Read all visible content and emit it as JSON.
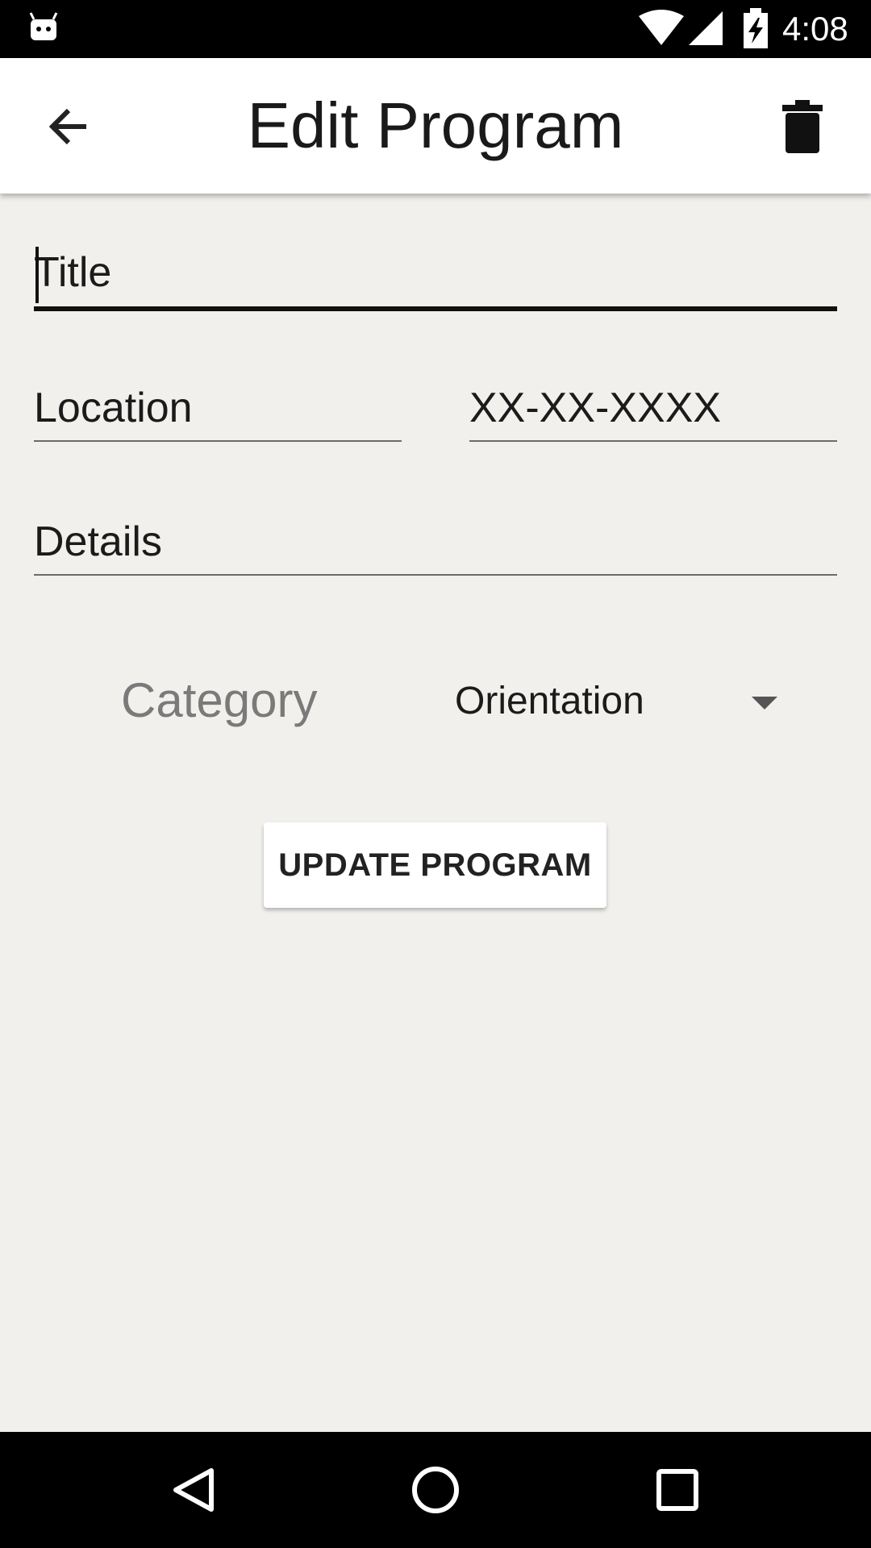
{
  "status_bar": {
    "time": "4:08",
    "icons": [
      "android-notification-icon",
      "wifi-icon",
      "signal-icon",
      "battery-charging-icon"
    ]
  },
  "app_bar": {
    "title": "Edit Program",
    "back_icon": "arrow-back-icon",
    "delete_icon": "trash-icon"
  },
  "form": {
    "title_placeholder": "Title",
    "location_placeholder": "Location",
    "date_placeholder": "XX-XX-XXXX",
    "details_placeholder": "Details",
    "category_label": "Category",
    "category_value": "Orientation",
    "submit_label": "UPDATE PROGRAM"
  },
  "nav_bar": {
    "buttons": [
      "back-triangle-icon",
      "home-circle-icon",
      "recents-square-icon"
    ]
  },
  "colors": {
    "background": "#f1f0ed",
    "app_bar": "#ffffff",
    "system_bars": "#000000",
    "hint_gray": "#7a7a7a"
  }
}
